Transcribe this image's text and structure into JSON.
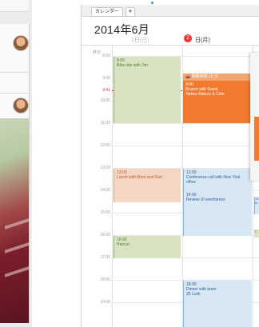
{
  "calendar": {
    "tab_label": "カレンダー",
    "add_tab": "+",
    "month_title": "2014年6月",
    "day1_label": "1日(日)",
    "day2_number": "2",
    "day2_label": "日(月)",
    "allday_label": "終日",
    "hours": [
      "8:00",
      "9:00",
      "10:00",
      "11:00",
      "12:00",
      "13:00",
      "14:00",
      "15:00",
      "16:00",
      "17:00",
      "18:00",
      "19:00"
    ],
    "now_label": "9:41",
    "events": {
      "bike": {
        "time": "8:00",
        "title": "Bike ride with Jim"
      },
      "travel": {
        "label": "移動時間 15 分"
      },
      "brunch": {
        "time": "9:00",
        "title": "Brunch with David",
        "location": "Tartine Bakery & Cafe"
      },
      "lunch": {
        "time": "13:00",
        "title": "Lunch with Mom and Dad"
      },
      "conf": {
        "time": "13:00",
        "title": "Conference call with New York office"
      },
      "review": {
        "time": "14:00",
        "title": "Review UI wireframes"
      },
      "haircut": {
        "time": "16:00",
        "title": "Haircut"
      },
      "dinner": {
        "time": "18:00",
        "title": "Dinner with team",
        "location": "25 Lusk"
      }
    },
    "side": {
      "blue_time": "13",
      "blue_text": "In",
      "green_text": "C"
    }
  },
  "colors": {
    "accent_red": "#e33333",
    "event_orange": "#f07a30",
    "event_green": "#d7e3c2",
    "event_blue": "#d8e7f4",
    "event_peach": "#f6d6c3"
  }
}
